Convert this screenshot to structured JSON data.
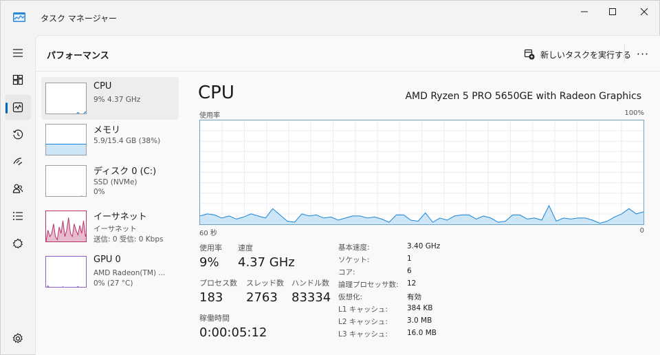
{
  "titlebar": {
    "title": "タスク マネージャー",
    "accent": "#0067c0"
  },
  "rail": {
    "items": [
      {
        "name": "menu-icon"
      },
      {
        "name": "processes-icon"
      },
      {
        "name": "performance-icon",
        "active": true
      },
      {
        "name": "app-history-icon"
      },
      {
        "name": "startup-apps-icon"
      },
      {
        "name": "users-icon"
      },
      {
        "name": "details-icon"
      },
      {
        "name": "services-icon"
      }
    ],
    "settings": "gear-icon"
  },
  "header": {
    "title": "パフォーマンス",
    "run_task_label": "新しいタスクを実行する",
    "more_label": "···"
  },
  "resources": [
    {
      "name": "CPU",
      "sub1": "9%  4.37 GHz",
      "sub2": "",
      "sub3": "",
      "selected": true,
      "color": "#1883d7"
    },
    {
      "name": "メモリ",
      "sub1": "5.9/15.4 GB (38%)",
      "sub2": "",
      "sub3": "",
      "color": "#1883d7"
    },
    {
      "name": "ディスク 0 (C:)",
      "sub1": "SSD (NVMe)",
      "sub2": "0%",
      "sub3": "",
      "color": "#4caf50"
    },
    {
      "name": "イーサネット",
      "sub1": "イーサネット",
      "sub2": "送信: 0 受信: 0 Kbps",
      "sub3": "",
      "color": "#b8336a"
    },
    {
      "name": "GPU 0",
      "sub1": "AMD Radeon(TM) ...",
      "sub2": "0%  (27 °C)",
      "sub3": "",
      "color": "#8a5fc7"
    }
  ],
  "detail": {
    "title": "CPU",
    "model": "AMD Ryzen 5 PRO 5650GE with Radeon Graphics",
    "chart_top_left": "使用率",
    "chart_top_right": "100%",
    "chart_bottom_left": "60 秒",
    "chart_bottom_right": "0"
  },
  "stats": {
    "usage_label": "使用率",
    "usage_value": "9%",
    "speed_label": "速度",
    "speed_value": "4.37 GHz",
    "processes_label": "プロセス数",
    "processes_value": "183",
    "threads_label": "スレッド数",
    "threads_value": "2763",
    "handles_label": "ハンドル数",
    "handles_value": "83334",
    "uptime_label": "稼働時間",
    "uptime_value": "0:00:05:12"
  },
  "specs": [
    {
      "key": "基本速度:",
      "value": "3.40 GHz"
    },
    {
      "key": "ソケット:",
      "value": "1"
    },
    {
      "key": "コア:",
      "value": "6"
    },
    {
      "key": "論理プロセッサ数:",
      "value": "12"
    },
    {
      "key": "仮想化:",
      "value": "有効"
    },
    {
      "key": "L1 キャッシュ:",
      "value": "384 KB"
    },
    {
      "key": "L2 キャッシュ:",
      "value": "3.0 MB"
    },
    {
      "key": "L3 キャッシュ:",
      "value": "16.0 MB"
    }
  ],
  "chart_data": {
    "type": "area",
    "title": "",
    "xlabel": "",
    "ylabel": "使用率",
    "ylim": [
      0,
      100
    ],
    "xlim": [
      60,
      0
    ],
    "x_tick_labels": [
      "60 秒",
      "0"
    ],
    "y_tick_labels": [
      "100%"
    ],
    "grid": true,
    "color": "#1883d7",
    "fill": "#cde6f7",
    "series": [
      {
        "values": [
          8,
          10,
          9,
          6,
          8,
          5,
          7,
          10,
          8,
          6,
          15,
          9,
          3,
          2,
          10,
          8,
          9,
          6,
          7,
          4,
          6,
          8,
          8,
          6,
          7,
          5,
          2,
          9,
          9,
          4,
          3,
          11,
          2,
          6,
          4,
          8,
          9,
          9,
          5,
          8,
          6,
          2,
          3,
          9,
          9,
          5,
          6,
          4,
          18,
          3,
          6,
          5,
          6,
          6,
          4,
          1,
          3,
          7,
          10,
          15,
          10,
          12
        ]
      }
    ]
  },
  "thumbs": {
    "cpu": [
      2,
      3,
      2,
      2,
      3,
      2,
      3,
      2,
      2,
      2,
      3,
      2,
      2,
      3,
      2,
      2,
      2,
      8,
      3,
      2,
      3,
      10,
      4
    ],
    "memory": 38,
    "disk": [
      0,
      0,
      0,
      0,
      0,
      0,
      0,
      0,
      1,
      0,
      0,
      0,
      0,
      0,
      0,
      0,
      0,
      0,
      0,
      5,
      0,
      0,
      0
    ],
    "ethernet": [
      5,
      40,
      20,
      30,
      60,
      20,
      10,
      50,
      30,
      70,
      20,
      40,
      80,
      30,
      20,
      60,
      40,
      25,
      55,
      30,
      70,
      20,
      40
    ],
    "gpu": [
      0,
      8,
      0,
      0,
      4,
      0,
      0,
      2,
      0,
      5,
      0,
      0,
      3,
      0,
      0,
      2,
      0,
      6,
      0,
      0,
      3,
      0,
      0
    ]
  }
}
